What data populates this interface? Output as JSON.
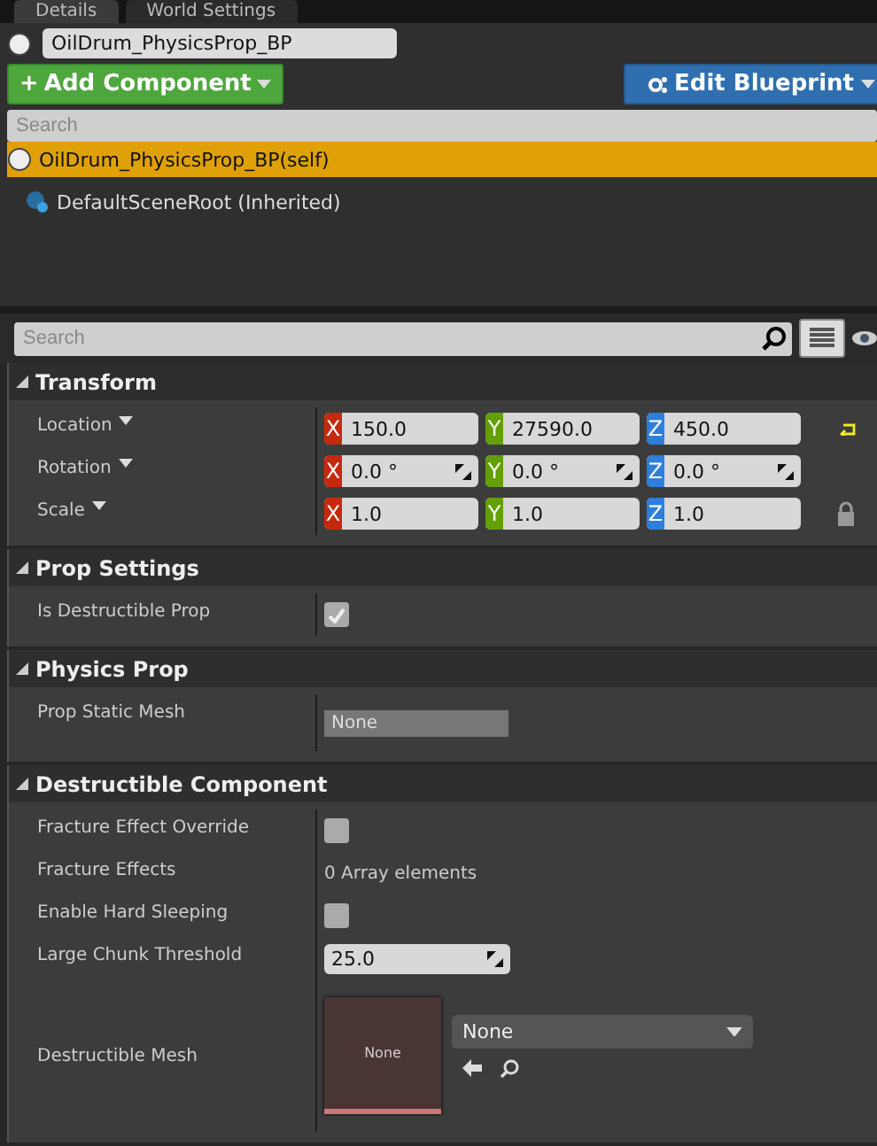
{
  "tabs": [
    {
      "label": "Details",
      "selected": true
    },
    {
      "label": "World Settings",
      "selected": false
    }
  ],
  "actor_name": "OilDrum_PhysicsProp_BP",
  "toolbar": {
    "add_icon": "+",
    "add_button": "Add Component",
    "edit_button": "Edit Blueprint"
  },
  "component_search": {
    "placeholder": "Search"
  },
  "components": [
    {
      "label": "OilDrum_PhysicsProp_BP(self)",
      "selected": true
    },
    {
      "label": "DefaultSceneRoot (Inherited)",
      "selected": false
    }
  ],
  "details_search": {
    "placeholder": "Search"
  },
  "sections": [
    {
      "title": "Transform",
      "expanded": true,
      "rows": [
        {
          "kind": "vector",
          "label": "Location",
          "reset_shown": true,
          "locked": false,
          "fields": [
            {
              "axis": "X",
              "value": "150.0",
              "spinner": false
            },
            {
              "axis": "Y",
              "value": "27590.0",
              "spinner": false
            },
            {
              "axis": "Z",
              "value": "450.0",
              "spinner": false
            }
          ]
        },
        {
          "kind": "vector",
          "label": "Rotation",
          "reset_shown": false,
          "locked": false,
          "fields": [
            {
              "axis": "X",
              "value": "0.0 °",
              "spinner": true
            },
            {
              "axis": "Y",
              "value": "0.0 °",
              "spinner": true
            },
            {
              "axis": "Z",
              "value": "0.0 °",
              "spinner": true
            }
          ]
        },
        {
          "kind": "vector",
          "label": "Scale",
          "reset_shown": false,
          "locked": true,
          "fields": [
            {
              "axis": "X",
              "value": "1.0",
              "spinner": false
            },
            {
              "axis": "Y",
              "value": "1.0",
              "spinner": false
            },
            {
              "axis": "Z",
              "value": "1.0",
              "spinner": false
            }
          ]
        }
      ]
    },
    {
      "title": "Prop Settings",
      "expanded": true,
      "rows": [
        {
          "kind": "checkbox",
          "label": "Is Destructible Prop",
          "checked": true
        }
      ]
    },
    {
      "title": "Physics Prop",
      "expanded": true,
      "rows": [
        {
          "kind": "asset_text",
          "label": "Prop Static Mesh",
          "value": "None"
        }
      ]
    },
    {
      "title": "Destructible Component",
      "expanded": true,
      "rows": [
        {
          "kind": "checkbox",
          "label": "Fracture Effect Override",
          "checked": false
        },
        {
          "kind": "text",
          "label": "Fracture Effects",
          "value": "0 Array elements"
        },
        {
          "kind": "checkbox",
          "label": "Enable Hard Sleeping",
          "checked": false
        },
        {
          "kind": "number",
          "label": "Large Chunk Threshold",
          "value": "25.0"
        },
        {
          "kind": "asset_picker",
          "label": "Destructible Mesh",
          "thumbnail": "None",
          "value": "None"
        }
      ]
    }
  ]
}
